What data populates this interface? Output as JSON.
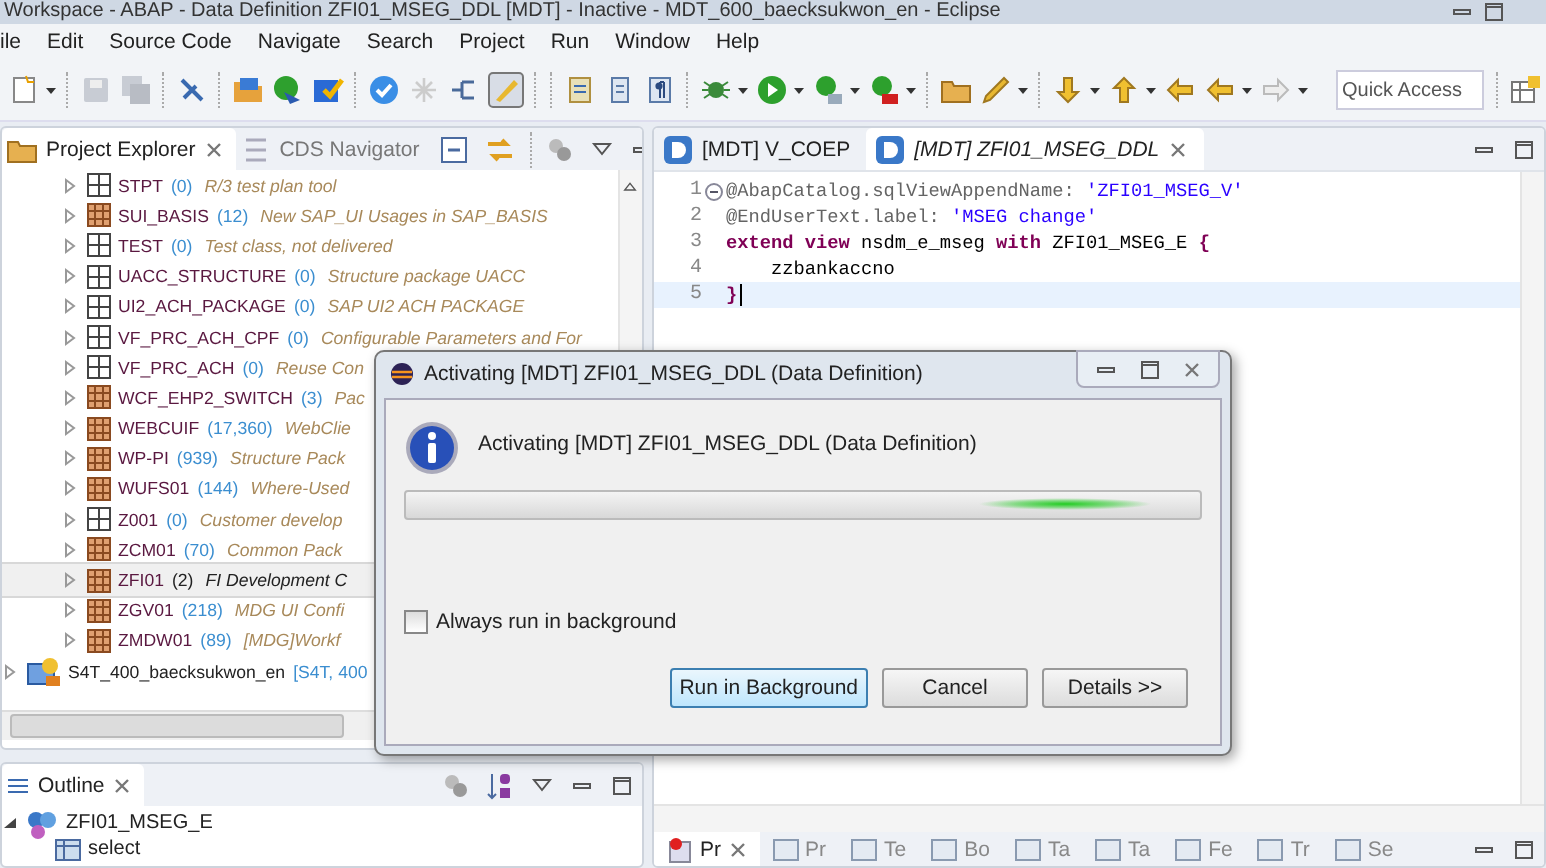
{
  "window": {
    "title": "Workspace - ABAP - Data Definition ZFI01_MSEG_DDL [MDT] - Inactive - MDT_600_baecksukwon_en - Eclipse"
  },
  "menu": [
    "ile",
    "Edit",
    "Source Code",
    "Navigate",
    "Search",
    "Project",
    "Run",
    "Window",
    "Help"
  ],
  "quick_access": {
    "placeholder": "Quick Access"
  },
  "project_explorer": {
    "tabs": [
      {
        "label": "Project Explorer",
        "selected": true
      },
      {
        "label": "CDS Navigator",
        "selected": false
      }
    ],
    "packages": [
      {
        "name": "STPT",
        "count": "(0)",
        "description": "R/3 test plan tool",
        "kind": "empty",
        "selected": false
      },
      {
        "name": "SUI_BASIS",
        "count": "(12)",
        "description": "New SAP_UI Usages in SAP_BASIS",
        "kind": "filled",
        "selected": false
      },
      {
        "name": "TEST",
        "count": "(0)",
        "description": "Test class, not delivered",
        "kind": "empty",
        "selected": false
      },
      {
        "name": "UACC_STRUCTURE",
        "count": "(0)",
        "description": "Structure package UACC",
        "kind": "empty",
        "selected": false
      },
      {
        "name": "UI2_ACH_PACKAGE",
        "count": "(0)",
        "description": "SAP UI2 ACH PACKAGE",
        "kind": "empty",
        "selected": false
      },
      {
        "name": "VF_PRC_ACH_CPF",
        "count": "(0)",
        "description": "Configurable Parameters and For",
        "kind": "empty",
        "selected": false
      },
      {
        "name": "VF_PRC_ACH",
        "count": "(0)",
        "description": "Reuse Con",
        "kind": "empty",
        "selected": false
      },
      {
        "name": "WCF_EHP2_SWITCH",
        "count": "(3)",
        "description": "Pac",
        "kind": "filled",
        "selected": false
      },
      {
        "name": "WEBCUIF",
        "count": "(17,360)",
        "description": "WebClie",
        "kind": "filled",
        "selected": false
      },
      {
        "name": "WP-PI",
        "count": "(939)",
        "description": "Structure Pack",
        "kind": "filled",
        "selected": false
      },
      {
        "name": "WUFS01",
        "count": "(144)",
        "description": "Where-Used",
        "kind": "filled",
        "selected": false
      },
      {
        "name": "Z001",
        "count": "(0)",
        "description": "Customer develop",
        "kind": "empty",
        "selected": false
      },
      {
        "name": "ZCM01",
        "count": "(70)",
        "description": "Common Pack",
        "kind": "filled",
        "selected": false
      },
      {
        "name": "ZFI01",
        "count": "(2)",
        "description": "FI Development C",
        "kind": "filled",
        "selected": true
      },
      {
        "name": "ZGV01",
        "count": "(218)",
        "description": "MDG UI Confi",
        "kind": "filled",
        "selected": false
      },
      {
        "name": "ZMDW01",
        "count": "(89)",
        "description": "[MDG]Workf",
        "kind": "filled",
        "selected": false
      }
    ],
    "project": {
      "name": "S4T_400_baecksukwon_en",
      "detail": "[S4T, 400"
    }
  },
  "outline": {
    "tab": "Outline",
    "tree": [
      {
        "label": "ZFI01_MSEG_E",
        "expanded": true,
        "children": [
          {
            "label": "select"
          }
        ]
      }
    ]
  },
  "editor": {
    "tabs": [
      {
        "label": "[MDT] V_COEP",
        "selected": false,
        "inactive": false
      },
      {
        "label": "[MDT] ZFI01_MSEG_DDL",
        "selected": true,
        "inactive": true
      }
    ],
    "lines": [
      {
        "number": "1",
        "fold": true,
        "current": false,
        "tokens": [
          {
            "text": "@AbapCatalog.sqlViewAppendName: ",
            "kind": "annotation"
          },
          {
            "text": "'ZFI01_MSEG_V'",
            "kind": "string"
          }
        ]
      },
      {
        "number": "2",
        "fold": false,
        "current": false,
        "tokens": [
          {
            "text": "@EndUserText.label: ",
            "kind": "annotation"
          },
          {
            "text": "'MSEG change'",
            "kind": "string"
          }
        ]
      },
      {
        "number": "3",
        "fold": false,
        "current": false,
        "tokens": [
          {
            "text": "extend view",
            "kind": "keyword"
          },
          {
            "text": " nsdm_e_mseg ",
            "kind": "plain"
          },
          {
            "text": "with",
            "kind": "keyword"
          },
          {
            "text": " ZFI01_MSEG_E ",
            "kind": "plain"
          },
          {
            "text": "{",
            "kind": "keyword"
          }
        ]
      },
      {
        "number": "4",
        "fold": false,
        "current": false,
        "tokens": [
          {
            "text": "    zzbankaccno",
            "kind": "plain"
          }
        ]
      },
      {
        "number": "5",
        "fold": false,
        "current": true,
        "tokens": [
          {
            "text": "}",
            "kind": "keyword"
          }
        ]
      }
    ]
  },
  "bottom_tabs": [
    {
      "label": "Pr",
      "selected": true
    },
    {
      "label": "Pr",
      "selected": false
    },
    {
      "label": "Te",
      "selected": false
    },
    {
      "label": "Bo",
      "selected": false
    },
    {
      "label": "Ta",
      "selected": false
    },
    {
      "label": "Ta",
      "selected": false
    },
    {
      "label": "Fe",
      "selected": false
    },
    {
      "label": "Tr",
      "selected": false
    },
    {
      "label": "Se",
      "selected": false
    }
  ],
  "dialog": {
    "title": "Activating [MDT] ZFI01_MSEG_DDL (Data Definition)",
    "message": "Activating [MDT] ZFI01_MSEG_DDL (Data Definition)",
    "progress": {
      "indeterminate": true
    },
    "checkbox": {
      "label": "Always run in background",
      "checked": false
    },
    "buttons": [
      {
        "label": "Run in Background",
        "default": true
      },
      {
        "label": "Cancel",
        "default": false
      },
      {
        "label": "Details >>",
        "default": false
      }
    ]
  }
}
